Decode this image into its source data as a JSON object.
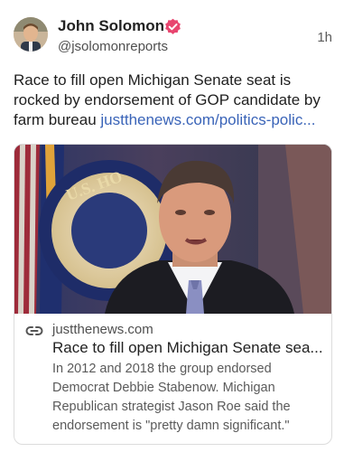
{
  "post": {
    "author_name": "John Solomon",
    "handle": "@jsolomonreports",
    "timestamp": "1h",
    "text": "Race to fill open Michigan Senate seat is rocked by endorsement of GOP candidate by farm bureau ",
    "link_text": "justthenews.com/politics-polic..."
  },
  "card": {
    "image_caption_text": "U.S. HO",
    "domain": "justthenews.com",
    "title": "Race to fill open Michigan Senate sea...",
    "description": "In 2012 and 2018 the group endorsed Democrat Debbie Stabenow. Michigan Republican strategist Jason Roe said the endorsement is \"pretty damn significant.\""
  },
  "icons": {
    "verified": "verified-badge-icon",
    "link": "link-icon"
  },
  "colors": {
    "verified": "#e8456f",
    "link": "#3a64b8"
  }
}
